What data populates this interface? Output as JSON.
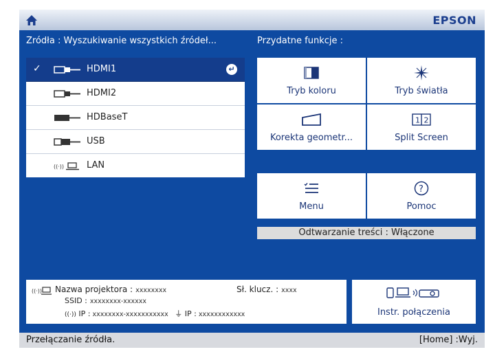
{
  "header": {
    "brand": "EPSON"
  },
  "sources": {
    "heading": "Źródła : Wyszukiwanie wszystkich źródeł...",
    "items": [
      {
        "label": "HDMI1",
        "icon": "hdmi-icon",
        "selected": true
      },
      {
        "label": "HDMI2",
        "icon": "hdmi-icon",
        "selected": false
      },
      {
        "label": "HDBaseT",
        "icon": "hdbaset-icon",
        "selected": false
      },
      {
        "label": "USB",
        "icon": "usb-icon",
        "selected": false
      },
      {
        "label": "LAN",
        "icon": "lan-icon",
        "selected": false
      }
    ]
  },
  "functions": {
    "heading": "Przydatne funkcje :",
    "tiles": [
      {
        "label": "Tryb koloru",
        "icon": "color-mode-icon"
      },
      {
        "label": "Tryb światła",
        "icon": "light-mode-icon"
      },
      {
        "label": "Korekta geometr...",
        "icon": "geometry-correction-icon"
      },
      {
        "label": "Split Screen",
        "icon": "split-screen-icon"
      },
      {
        "label": "Menu",
        "icon": "menu-icon"
      },
      {
        "label": "Pomoc",
        "icon": "help-icon"
      }
    ],
    "playback": "Odtwarzanie treści  :  Włączone"
  },
  "info": {
    "projector_name_label": "Nazwa projektora :",
    "projector_name_value": "xxxxxxxx",
    "key_label": "Sł. klucz. :",
    "key_value": "xxxx",
    "ssid_label": "SSID  :",
    "ssid_value": "xxxxxxxx-xxxxxx",
    "ip_wireless_label": "IP :",
    "ip_wireless_value": "xxxxxxxx-xxxxxxxxxxx",
    "ip_wired_label": "IP :",
    "ip_wired_value": "xxxxxxxxxxxx"
  },
  "connection": {
    "label": "Instr. połączenia"
  },
  "footer": {
    "left": "Przełączanie źródła.",
    "right": "[Home] :Wyj."
  },
  "colors": {
    "background": "#0e4aa1",
    "selected": "#143d8c",
    "brand": "#1b3e8e",
    "tile_text": "#1b3577"
  }
}
